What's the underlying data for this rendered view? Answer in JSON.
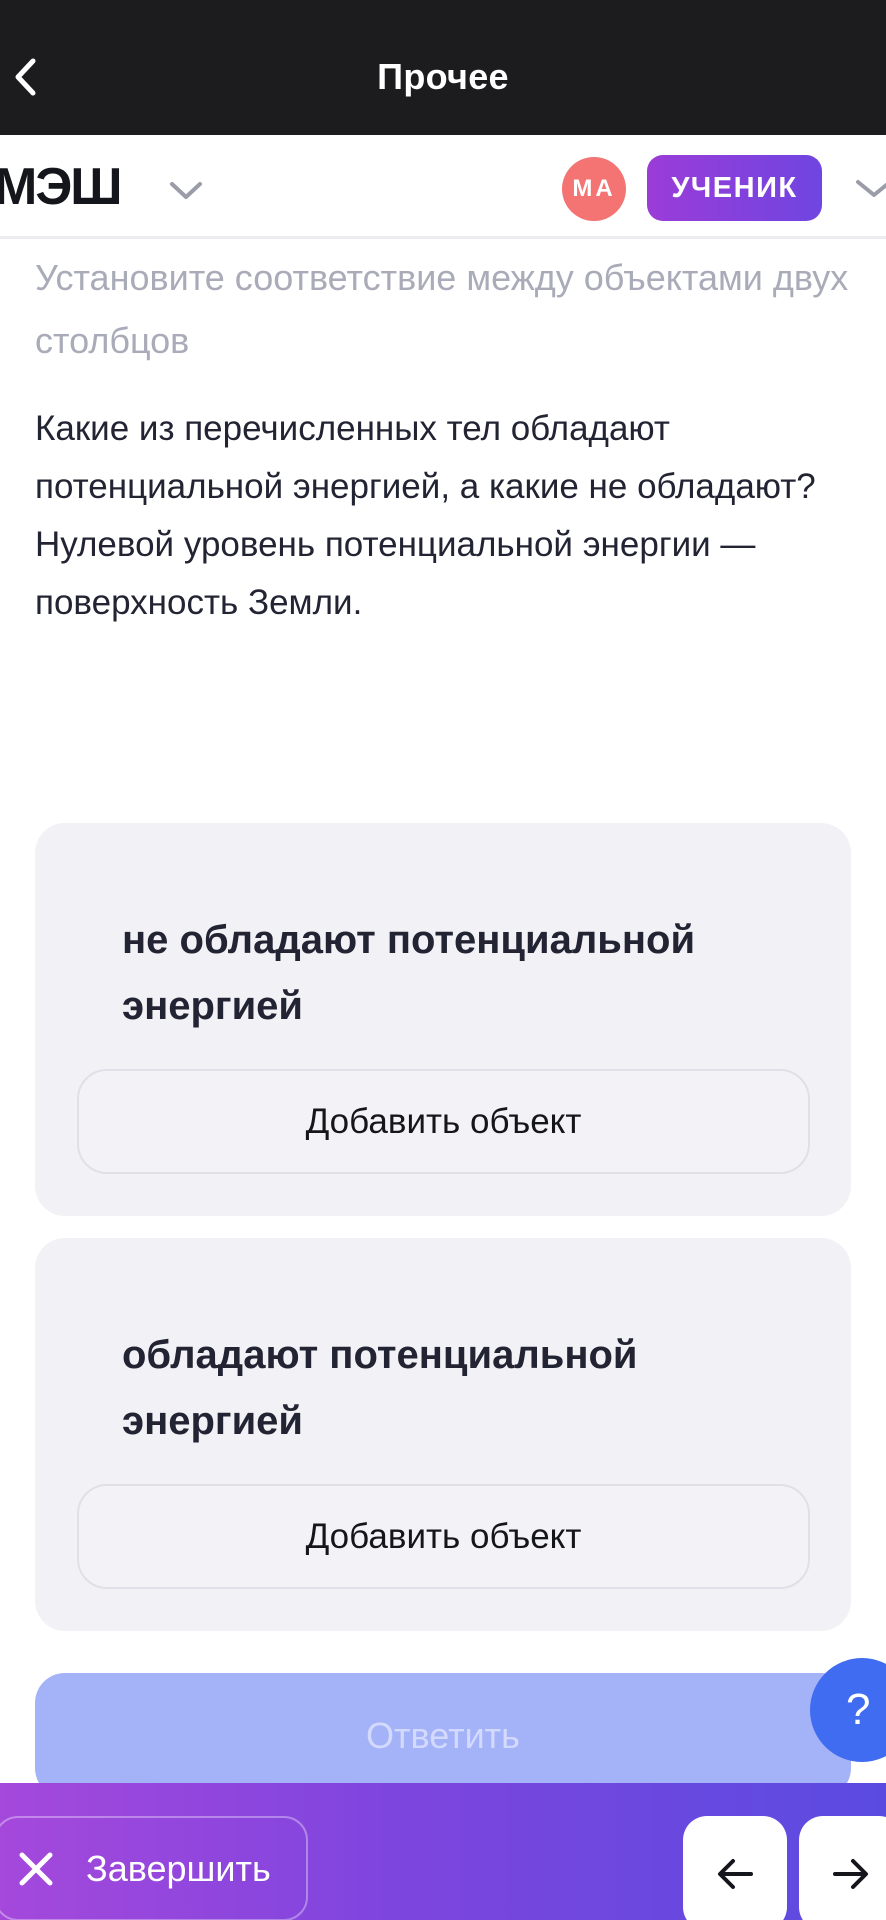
{
  "topbar": {
    "title": "Прочее",
    "back_icon": "chevron-left-icon"
  },
  "header": {
    "logo": "МЭШ",
    "avatar_initials": "МА",
    "role": "УЧЕНИК",
    "avatar_color": "#f47373",
    "role_color": "#7b42dd"
  },
  "task": {
    "instruction": "Установите соответствие между объектами двух столбцов",
    "question": "Какие из перечисленных тел обладают потенциальной энергией, а какие не обладают? Нулевой уровень потенциальной энергии — поверхность Земли."
  },
  "categories": [
    {
      "title": "не обладают потенциальной энергией",
      "add_label": "Добавить объект"
    },
    {
      "title": "обладают потенциальной энергией",
      "add_label": "Добавить объект"
    }
  ],
  "answer_label": "Ответить",
  "help_label": "?",
  "bottombar": {
    "finish_label": "Завершить",
    "prev_icon": "arrow-left-icon",
    "next_icon": "arrow-right-icon"
  }
}
